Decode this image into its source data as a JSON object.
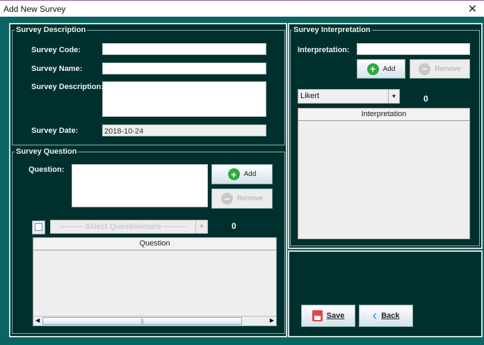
{
  "window": {
    "title": "Add New Survey",
    "close": "✕"
  },
  "desc": {
    "legend": "Survey Description",
    "code_label": "Survey Code:",
    "code_value": "",
    "name_label": "Survey Name:",
    "name_value": "",
    "description_label": "Survey Description:",
    "date_label": "Survey Date:",
    "date_value": "2018-10-24"
  },
  "question": {
    "legend": "Survey Question",
    "question_label": "Question:",
    "add": "Add",
    "remove": "Remove",
    "select_placeholder": "——— Select Questionnaire ———",
    "count": "0",
    "table_header": "Question"
  },
  "interp": {
    "legend": "Survey Interpretation",
    "label": "Interpretation:",
    "add": "Add",
    "remove": "Remove",
    "type": "Likert",
    "count": "0",
    "table_header": "Interpretation"
  },
  "actions": {
    "save": "Save",
    "back": "Back"
  }
}
